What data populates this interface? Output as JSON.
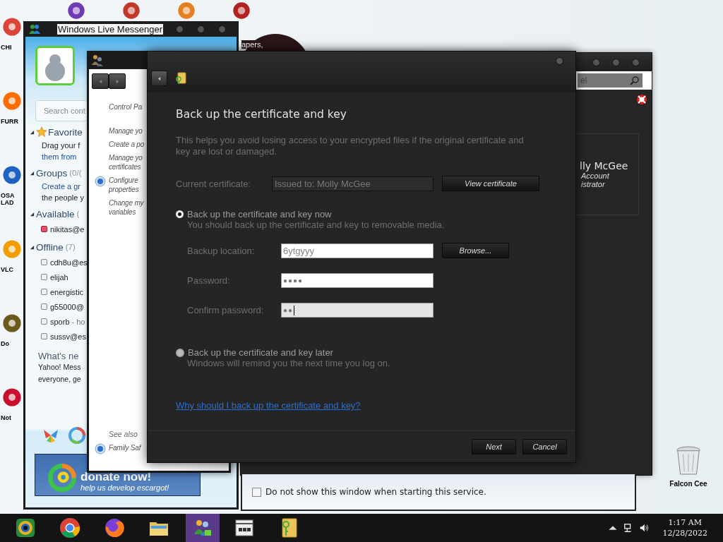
{
  "desktop": {
    "icons": [
      {
        "label": "CHI"
      },
      {
        "label": "FURR"
      },
      {
        "label": "OSA LAD"
      },
      {
        "label": "VLC"
      },
      {
        "label": "Do"
      },
      {
        "label": "Not"
      }
    ],
    "recycle_bin": {
      "label": "Falcon Cee"
    },
    "wallpaper_text": "apers,"
  },
  "messenger": {
    "title": "Windows Live Messenger",
    "search": {
      "placeholder": "Search cont"
    },
    "sections": [
      {
        "kind": "favorites",
        "name": "Favorite",
        "expanded": true,
        "lines": [
          {
            "kind": "text",
            "text": "Drag your f"
          },
          {
            "kind": "link",
            "text": "them from"
          }
        ]
      },
      {
        "kind": "group",
        "name": "Groups",
        "count": "(0/(",
        "expanded": true,
        "lines": [
          {
            "kind": "link",
            "text": "Create a gr"
          },
          {
            "kind": "text",
            "text": "the people y"
          }
        ]
      },
      {
        "kind": "group",
        "name": "Available",
        "count": "(",
        "expanded": true,
        "contacts": [
          {
            "name": "nikitas@e",
            "busy": true
          }
        ]
      },
      {
        "kind": "group",
        "name": "Offline",
        "count": "(7)",
        "expanded": true,
        "contacts": [
          {
            "name": "cdh8u@es",
            "busy": false
          },
          {
            "name": "elijah",
            "busy": false
          },
          {
            "name": "energistic",
            "busy": false
          },
          {
            "name": "g55000@",
            "busy": false
          },
          {
            "name": "sporb",
            "note": "- ho",
            "busy": false
          },
          {
            "name": "sussv@es",
            "busy": false
          }
        ]
      }
    ],
    "whats_new": {
      "title": "What's ne",
      "lines": [
        "Yahoo! Mess",
        "everyone, ge"
      ]
    },
    "banner": {
      "headline": "donate now!",
      "tagline": "help us develop escargot!"
    }
  },
  "control_panel": {
    "breadcrumb": "Control Pa",
    "tasks": [
      {
        "lines": [
          "Manage yo"
        ],
        "shield": false
      },
      {
        "lines": [
          "Create a po"
        ],
        "shield": false
      },
      {
        "lines": [
          "Manage yo",
          "certificates"
        ],
        "shield": false
      },
      {
        "lines": [
          "Configure",
          "properties"
        ],
        "shield": true
      },
      {
        "lines": [
          "Change my",
          "variables"
        ],
        "shield": false
      }
    ],
    "see_also": {
      "title": "See also",
      "links": [
        {
          "text": "Family Saf",
          "shield": true
        }
      ]
    }
  },
  "user_accounts": {
    "search": {
      "placeholder": "el"
    },
    "user": {
      "name": "lly McGee",
      "lines": [
        "Account",
        "istrator"
      ]
    },
    "checkbox": {
      "label": "Do not show this window when starting this service.",
      "checked": false
    }
  },
  "dialog": {
    "heading": "Back up the certificate and key",
    "description": "This helps you avoid losing access to your encrypted files if the original certificate and key are lost or damaged.",
    "current_certificate": {
      "label": "Current certificate:",
      "value": "Issued to: Molly McGee",
      "button": "View certificate"
    },
    "options": [
      {
        "label": "Back up the certificate and key now",
        "hint": "You should back up the certificate and key to removable media.",
        "selected": true
      },
      {
        "label": "Back up the certificate and key later",
        "hint": "Windows will remind you the next time you log on.",
        "selected": false
      }
    ],
    "fields": [
      {
        "label": "Backup location:",
        "value": "6ytgyyy",
        "kind": "text",
        "button": "Browse...",
        "focused": false
      },
      {
        "label": "Password:",
        "value": "●●●●",
        "kind": "password",
        "focused": false
      },
      {
        "label": "Confirm password:",
        "value": "●●",
        "kind": "password",
        "focused": true
      }
    ],
    "link": "Why should I back up the certificate and key?",
    "buttons": [
      "Next",
      "Cancel"
    ]
  },
  "taskbar": {
    "apps": [
      {
        "kind": "ring",
        "active": false
      },
      {
        "kind": "browser",
        "active": false
      },
      {
        "kind": "fox",
        "active": false
      },
      {
        "kind": "folder",
        "active": false
      },
      {
        "kind": "people",
        "active": true
      },
      {
        "kind": "box",
        "active": false
      },
      {
        "kind": "keyfolder",
        "active": false
      }
    ],
    "time": "1:17 AM",
    "date": "12/28/2022"
  }
}
